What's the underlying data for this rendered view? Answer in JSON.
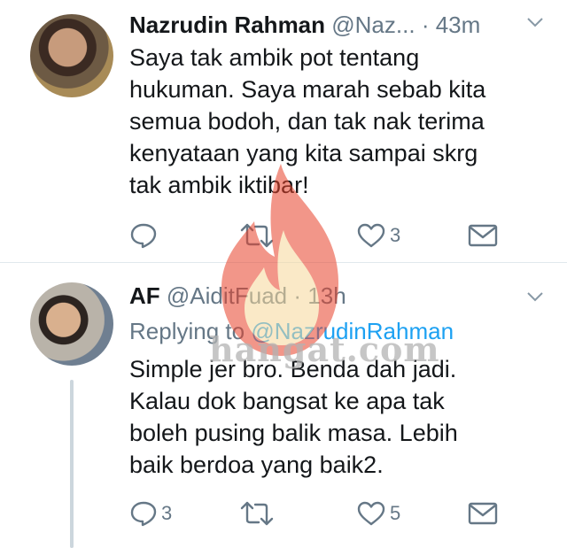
{
  "tweets": [
    {
      "name": "Nazrudin Rahman",
      "handle": "@Naz...",
      "separator": "·",
      "time": "43m",
      "avatar_icon": "profile-photo",
      "body_lines": [
        "Saya tak ambik pot tentang",
        "hukuman. Saya marah sebab kita",
        "semua bodoh, dan tak nak terima",
        "kenyataan yang kita sampai skrg",
        "tak ambik iktibar!"
      ],
      "reply_count": "",
      "retweet_count": "",
      "like_count": "3"
    },
    {
      "name": "AF",
      "handle": "@AiditFuad",
      "separator": "·",
      "time": "13h",
      "avatar_icon": "profile-photo",
      "replying_prefix": "Replying to",
      "replying_to": "@NazrudinRahman",
      "body_lines": [
        "Simple jer bro. Benda dah jadi.",
        "Kalau dok bangsat ke apa tak",
        "boleh pusing balik masa. Lebih",
        "baik berdoa yang baik2."
      ],
      "reply_count": "3",
      "retweet_count": "",
      "like_count": "5"
    }
  ],
  "watermark": {
    "text": "hangat.com",
    "icon": "flame-logo"
  },
  "colors": {
    "text": "#14171a",
    "secondary": "#657786",
    "link": "#1da1f2",
    "divider": "#e1e8ed",
    "thread_line": "#ccd6dd",
    "flame": "#e8422a"
  }
}
